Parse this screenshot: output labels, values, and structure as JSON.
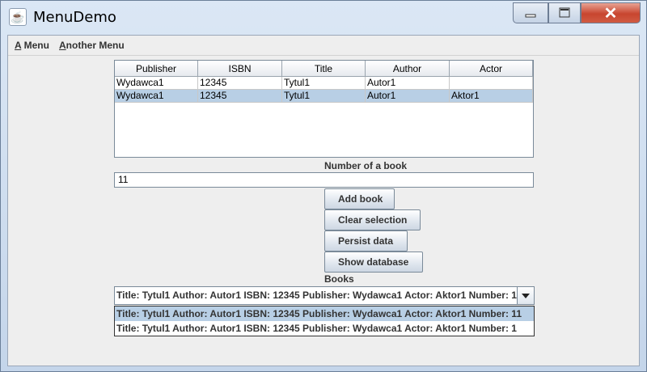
{
  "window": {
    "title": "MenuDemo",
    "close_glyph": "✕"
  },
  "menubar": {
    "items": [
      {
        "mnemonic": "A",
        "rest": " Menu"
      },
      {
        "mnemonic": "A",
        "rest": "nother Menu"
      }
    ]
  },
  "table": {
    "columns": [
      "Publisher",
      "ISBN",
      "Title",
      "Author",
      "Actor"
    ],
    "rows": [
      [
        "Wydawca1",
        "12345",
        "Tytul1",
        "Autor1",
        ""
      ],
      [
        "Wydawca1",
        "12345",
        "Tytul1",
        "Autor1",
        "Aktor1"
      ]
    ],
    "selected_row": 1
  },
  "number_label": "Number of a book",
  "number_field": {
    "value": "11"
  },
  "buttons": {
    "add": "Add book",
    "clear": "Clear selection",
    "persist": "Persist data",
    "show": "Show database"
  },
  "books_label": "Books",
  "combo": {
    "selected": "Title: Tytul1 Author: Autor1 ISBN: 12345 Publisher: Wydawca1 Actor: Aktor1 Number: 11",
    "options": [
      "Title: Tytul1 Author: Autor1 ISBN: 12345 Publisher: Wydawca1 Actor: Aktor1 Number: 11",
      "Title: Tytul1 Author: Autor1 ISBN: 12345 Publisher: Wydawca1 Actor: Aktor1 Number: 1"
    ]
  },
  "colors": {
    "selection": "#b8cfe5",
    "close_button": "#c8452f"
  }
}
